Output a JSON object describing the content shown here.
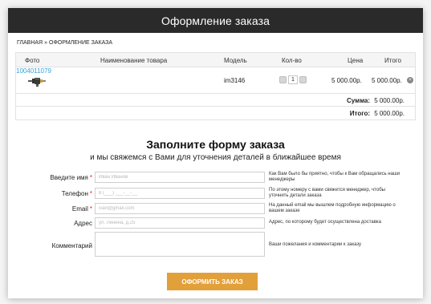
{
  "header": {
    "title": "Оформление заказа"
  },
  "breadcrumb": {
    "home": "Главная",
    "separator": "»",
    "current": "Оформление заказа"
  },
  "cart": {
    "columns": {
      "photo": "Фото",
      "name": "Наименование товара",
      "model": "Модель",
      "qty": "Кол-во",
      "price": "Цена",
      "total": "Итого"
    },
    "item": {
      "image_icon": "product-tool-icon",
      "name": "1004011079",
      "model": "im3146",
      "qty": "1",
      "price": "5 000.00р.",
      "total": "5 000.00р."
    },
    "summary": [
      {
        "label": "Сумма:",
        "value": "5 000.00р."
      },
      {
        "label": "Итого:",
        "value": "5 000.00р."
      }
    ]
  },
  "form": {
    "title": "Заполните форму заказа",
    "subtitle": "и мы свяжемся с Вами для уточнения деталей в ближайшее время",
    "fields": {
      "name": {
        "label": "Введите имя",
        "required_mark": "*",
        "placeholder": "Иван Иванов",
        "hint": "Как Вам было бы приятно, чтобы к Вам обращались наши менеджеры"
      },
      "phone": {
        "label": "Телефон",
        "required_mark": "*",
        "placeholder": "8 (___) ___-__-__",
        "hint": "По этому номеру с вами свяжется менеджер, чтобы уточнить детали заказа"
      },
      "email": {
        "label": "Email",
        "required_mark": "*",
        "placeholder": "ivan@gmail.com",
        "hint": "На данный email мы вышлем подробную информацию о вашем заказе"
      },
      "address": {
        "label": "Адрес",
        "placeholder": "ул. Ленина, д.25",
        "hint": "Адрес, по которому будет осуществлена доставка"
      },
      "comment": {
        "label": "Комментарий",
        "placeholder": "",
        "hint": "Ваши пожелания и комментарии к заказу"
      }
    },
    "submit_label": "Оформить заказ"
  },
  "colors": {
    "header_bg": "#2a2a2a",
    "link": "#3aa0d8",
    "required": "#d8232a",
    "submit_bg": "#e2a03a"
  }
}
